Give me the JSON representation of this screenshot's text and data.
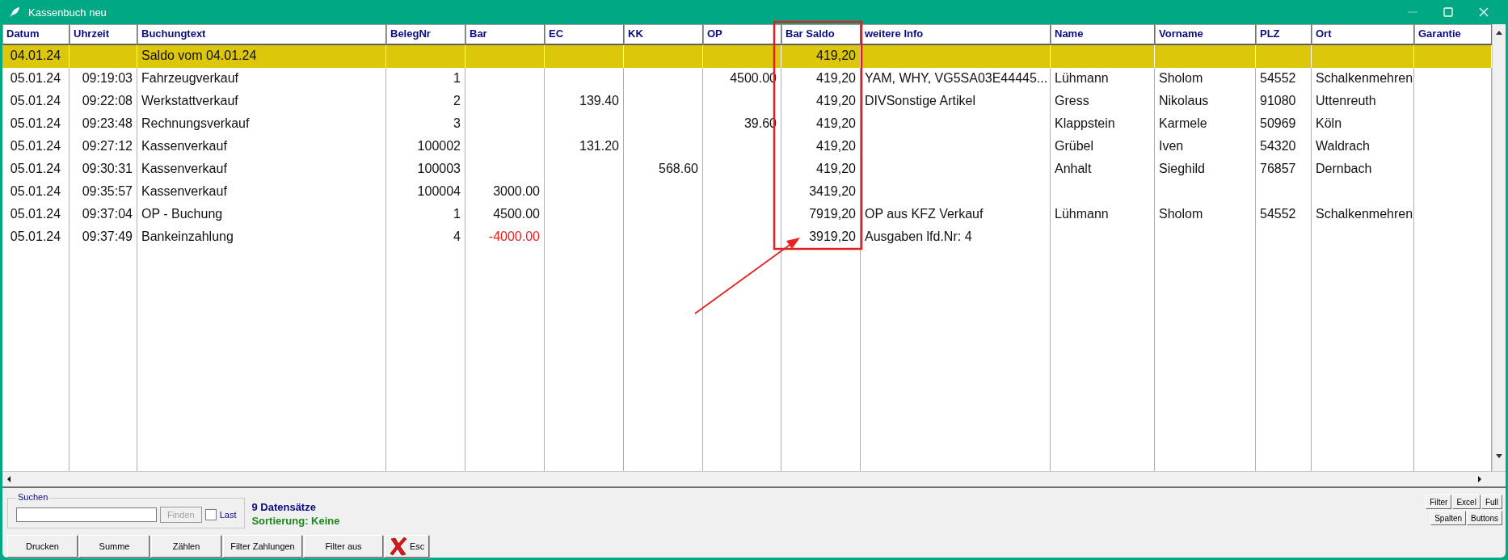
{
  "window": {
    "title": "Kassenbuch neu"
  },
  "table": {
    "columns": [
      "Datum",
      "Uhrzeit",
      "Buchungtext",
      "BelegNr",
      "Bar",
      "EC",
      "KK",
      "OP",
      "Bar Saldo",
      "weitere Info",
      "Name",
      "Vorname",
      "PLZ",
      "Ort",
      "Garantie"
    ],
    "rows": [
      {
        "kind": "saldo",
        "cells": [
          "04.01.24",
          null,
          "Saldo vom 04.01.24",
          null,
          null,
          null,
          null,
          null,
          "419,20",
          null,
          null,
          null,
          null,
          null,
          null
        ]
      },
      {
        "kind": "entry",
        "cells": [
          "05.01.24",
          "09:19:03",
          "Fahrzeugverkauf",
          "1",
          null,
          null,
          null,
          "4500.00",
          "419,20",
          "YAM, WHY, VG5SA03E44445...",
          "Lühmann",
          "Sholom",
          "54552",
          "Schalkenmehren",
          null
        ]
      },
      {
        "kind": "entry",
        "cells": [
          "05.01.24",
          "09:22:08",
          "Werkstattverkauf",
          "2",
          null,
          "139.40",
          null,
          null,
          "419,20",
          "DIVSonstige Artikel",
          "Gress",
          "Nikolaus",
          "91080",
          "Uttenreuth",
          null
        ]
      },
      {
        "kind": "entry",
        "cells": [
          "05.01.24",
          "09:23:48",
          "Rechnungsverkauf",
          "3",
          null,
          null,
          null,
          "39.60",
          "419,20",
          null,
          "Klappstein",
          "Karmele",
          "50969",
          "Köln",
          null
        ]
      },
      {
        "kind": "entry",
        "cells": [
          "05.01.24",
          "09:27:12",
          "Kassenverkauf",
          "100002",
          null,
          "131.20",
          null,
          null,
          "419,20",
          null,
          "Grübel",
          "Iven",
          "54320",
          "Waldrach",
          null
        ]
      },
      {
        "kind": "entry",
        "cells": [
          "05.01.24",
          "09:30:31",
          "Kassenverkauf",
          "100003",
          null,
          null,
          "568.60",
          null,
          "419,20",
          null,
          "Anhalt",
          "Sieghild",
          "76857",
          "Dernbach",
          null
        ]
      },
      {
        "kind": "entry",
        "cells": [
          "05.01.24",
          "09:35:57",
          "Kassenverkauf",
          "100004",
          {
            "text": "3000.00",
            "negative": false
          },
          null,
          null,
          null,
          "3419,20",
          null,
          null,
          null,
          null,
          null,
          null
        ]
      },
      {
        "kind": "entry",
        "cells": [
          "05.01.24",
          "09:37:04",
          "OP - Buchung",
          "1",
          {
            "text": "4500.00",
            "negative": false
          },
          null,
          null,
          null,
          "7919,20",
          "OP aus KFZ Verkauf",
          "Lühmann",
          "Sholom",
          "54552",
          "Schalkenmehren",
          null
        ]
      },
      {
        "kind": "entry",
        "cells": [
          "05.01.24",
          "09:37:49",
          "Bankeinzahlung",
          "4",
          {
            "text": "-4000.00",
            "negative": true
          },
          null,
          null,
          null,
          "3919,20",
          "Ausgaben lfd.Nr: 4",
          null,
          null,
          null,
          null,
          null
        ]
      }
    ]
  },
  "search": {
    "legend": "Suchen",
    "find_button": {
      "label": "Finden",
      "disabled": true
    },
    "last_checkbox": {
      "label": "Last",
      "checked": false
    }
  },
  "status": {
    "count": "9 Datensätze",
    "sorting": "Sortierung: Keine"
  },
  "buttons": [
    "Drucken",
    "Summe",
    "Zählen",
    "Filter Zahlungen",
    "Filter aus"
  ],
  "esc_button": "Esc",
  "side_buttons": [
    [
      "Filter",
      "Excel",
      "Full"
    ],
    [
      "Spalten",
      "Buttons"
    ]
  ]
}
